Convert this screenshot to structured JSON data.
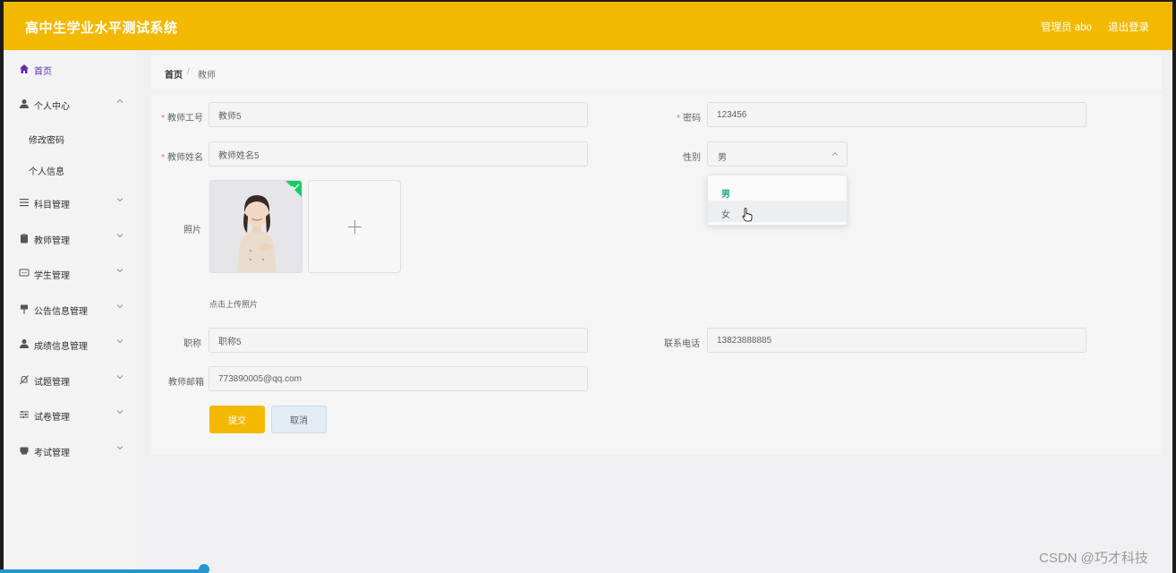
{
  "header": {
    "title": "高中生学业水平测试系统",
    "user": "管理员 abo",
    "logout": "退出登录",
    "color": "#f2b900"
  },
  "sidebar": {
    "items": [
      {
        "label": "首页",
        "icon": "home-icon",
        "active": true
      },
      {
        "label": "个人中心",
        "icon": "user-icon",
        "expanded": true,
        "children": [
          {
            "label": "修改密码"
          },
          {
            "label": "个人信息"
          }
        ]
      },
      {
        "label": "科目管理",
        "icon": "list-icon"
      },
      {
        "label": "教师管理",
        "icon": "clipboard-icon"
      },
      {
        "label": "学生管理",
        "icon": "chat-icon"
      },
      {
        "label": "公告信息管理",
        "icon": "sign-icon"
      },
      {
        "label": "成绩信息管理",
        "icon": "user-icon"
      },
      {
        "label": "试题管理",
        "icon": "bell-off-icon"
      },
      {
        "label": "试卷管理",
        "icon": "sliders-icon"
      },
      {
        "label": "考试管理",
        "icon": "box-icon"
      }
    ]
  },
  "breadcrumb": {
    "home": "首页",
    "separator": "/",
    "current": "教师"
  },
  "form": {
    "teacher_id": {
      "label": "教师工号",
      "value": "教师5",
      "required": true
    },
    "password": {
      "label": "密码",
      "value": "123456",
      "required": true
    },
    "teacher_name": {
      "label": "教师姓名",
      "value": "教师姓名5",
      "required": true
    },
    "gender": {
      "label": "性别",
      "value": "男",
      "options": [
        "男",
        "女"
      ],
      "selected": "男",
      "hovered": "女"
    },
    "photo": {
      "label": "照片",
      "hint": "点击上传照片"
    },
    "title": {
      "label": "职称",
      "value": "职称5"
    },
    "phone": {
      "label": "联系电话",
      "value": "13823888885"
    },
    "email": {
      "label": "教师邮箱",
      "value": "773890005@qq.com"
    },
    "submit": "提交",
    "cancel": "取消"
  },
  "watermark": "CSDN @巧才科技"
}
